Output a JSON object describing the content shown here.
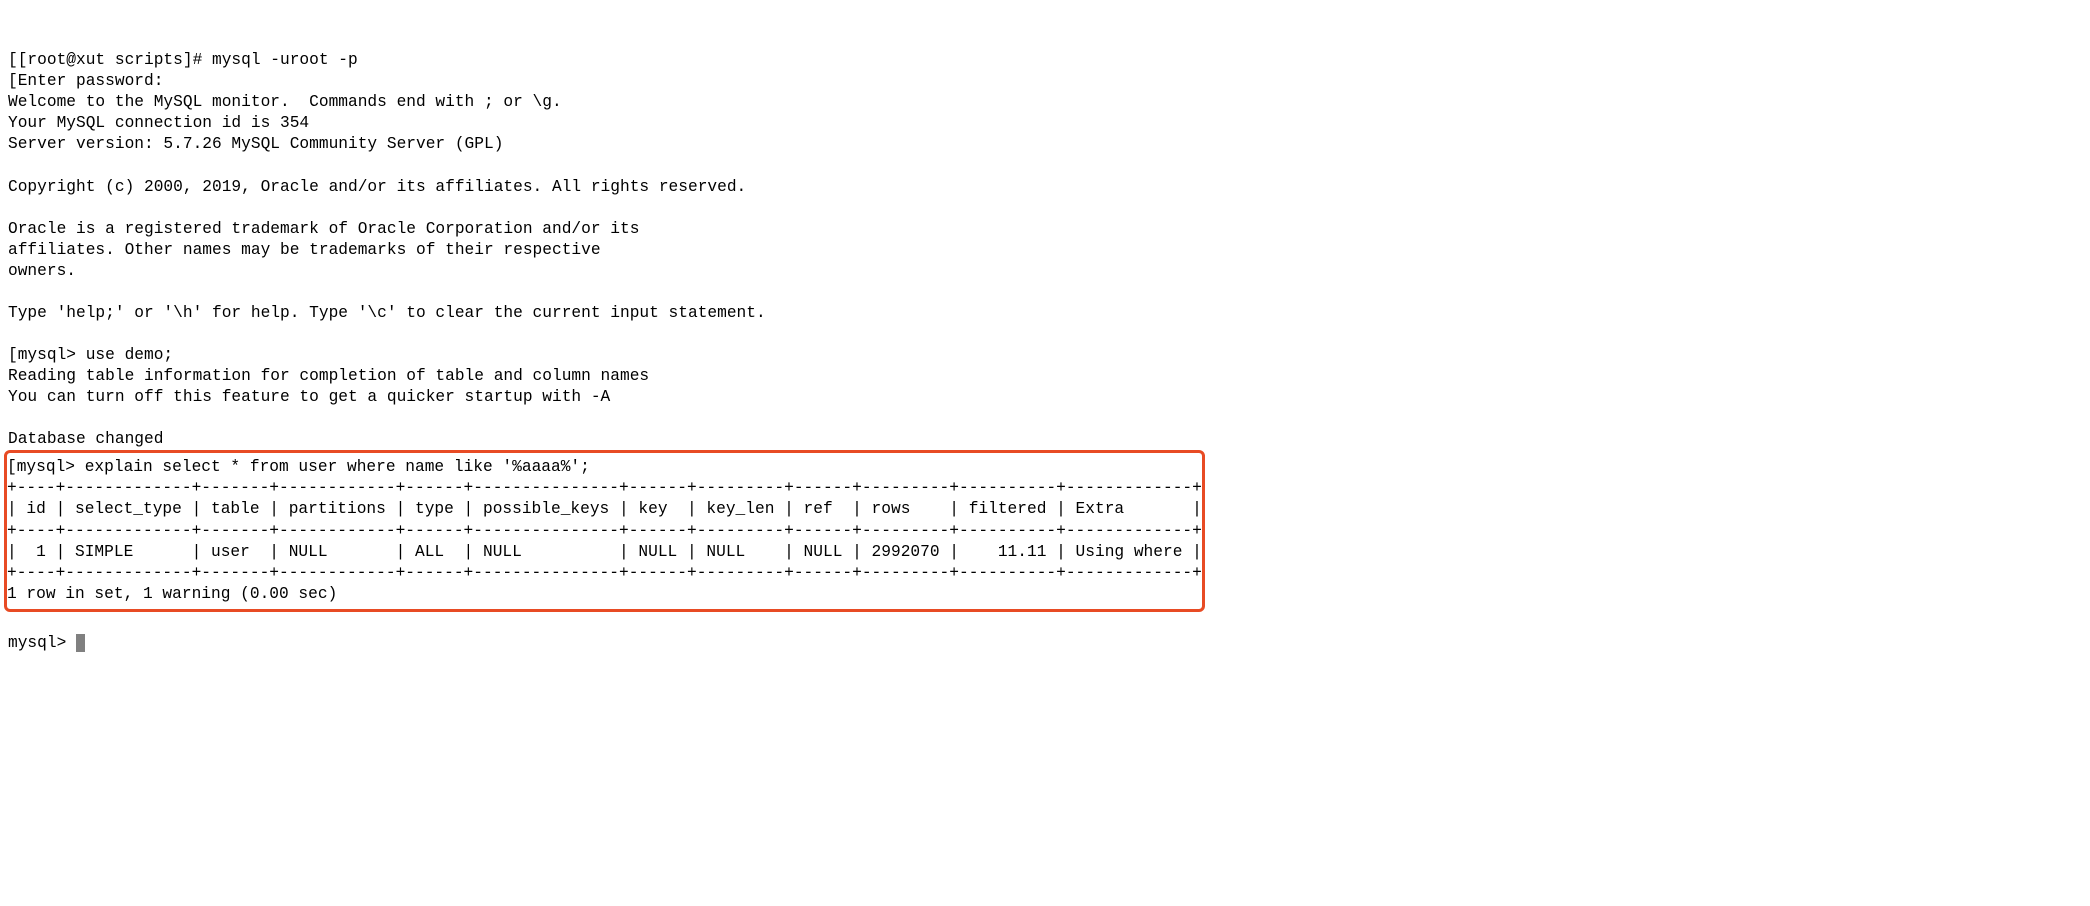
{
  "session": {
    "shell_prompt_open": "[[root@xut scripts]# ",
    "shell_command": "mysql -uroot -p",
    "enter_password_line_open": "[Enter password:",
    "welcome_line": "Welcome to the MySQL monitor.  Commands end with ; or \\g.",
    "connection_id_line": "Your MySQL connection id is 354",
    "server_version_line": "Server version: 5.7.26 MySQL Community Server (GPL)",
    "copyright_line": "Copyright (c) 2000, 2019, Oracle and/or its affiliates. All rights reserved.",
    "trademark_line1": "Oracle is a registered trademark of Oracle Corporation and/or its",
    "trademark_line2": "affiliates. Other names may be trademarks of their respective",
    "trademark_line3": "owners.",
    "help_line": "Type 'help;' or '\\h' for help. Type '\\c' to clear the current input statement."
  },
  "mysql": {
    "prompt_open": "[mysql> ",
    "prompt": "mysql> ",
    "use_demo_command": "use demo;",
    "reading_tables_line": "Reading table information for completion of table and column names",
    "turn_off_line": "You can turn off this feature to get a quicker startup with -A",
    "database_changed_line": "Database changed"
  },
  "highlighted": {
    "explain_command": "explain select * from user where name like '%aaaa%';",
    "table_border_top": "+----+-------------+-------+------------+------+---------------+------+---------+------+---------+----------+-------------+",
    "table_header": "| id | select_type | table | partitions | type | possible_keys | key  | key_len | ref  | rows    | filtered | Extra       |",
    "table_border_mid": "+----+-------------+-------+------------+------+---------------+------+---------+------+---------+----------+-------------+",
    "table_row": "|  1 | SIMPLE      | user  | NULL       | ALL  | NULL          | NULL | NULL    | NULL | 2992070 |    11.11 | Using where |",
    "table_border_bot": "+----+-------------+-------+------------+------+---------------+------+---------+------+---------+----------+-------------+",
    "result_summary": "1 row in set, 1 warning (0.00 sec)"
  },
  "explain_result": {
    "columns": [
      "id",
      "select_type",
      "table",
      "partitions",
      "type",
      "possible_keys",
      "key",
      "key_len",
      "ref",
      "rows",
      "filtered",
      "Extra"
    ],
    "rows": [
      {
        "id": "1",
        "select_type": "SIMPLE",
        "table": "user",
        "partitions": "NULL",
        "type": "ALL",
        "possible_keys": "NULL",
        "key": "NULL",
        "key_len": "NULL",
        "ref": "NULL",
        "rows": "2992070",
        "filtered": "11.11",
        "Extra": "Using where"
      }
    ],
    "row_count": 1,
    "warning_count": 1,
    "elapsed_sec": "0.00"
  }
}
